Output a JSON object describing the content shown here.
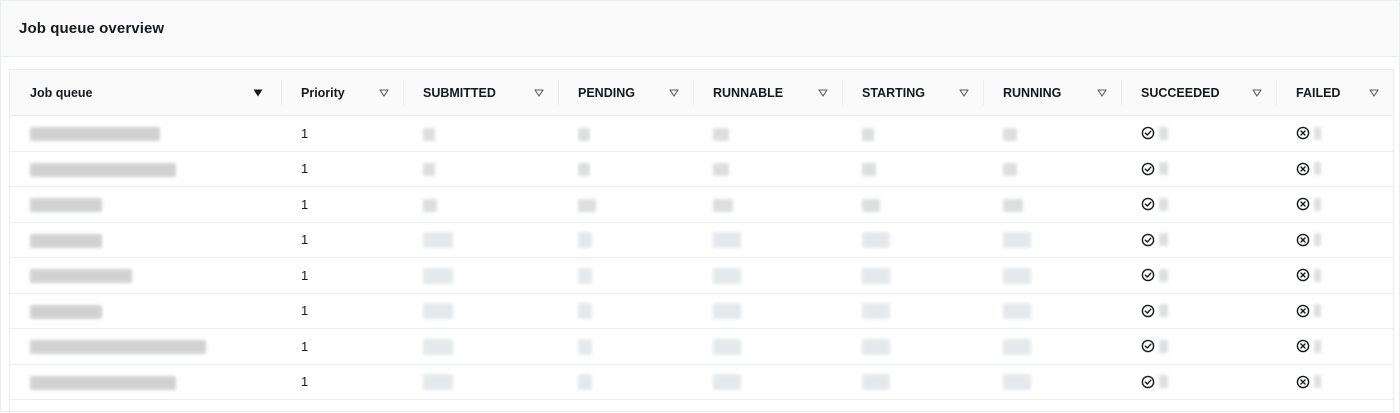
{
  "panel": {
    "title": "Job queue overview"
  },
  "table": {
    "columns": [
      {
        "key": "job_queue",
        "label": "Job queue",
        "sorted": true
      },
      {
        "key": "priority",
        "label": "Priority",
        "sorted": false
      },
      {
        "key": "submitted",
        "label": "SUBMITTED",
        "sorted": false
      },
      {
        "key": "pending",
        "label": "PENDING",
        "sorted": false
      },
      {
        "key": "runnable",
        "label": "RUNNABLE",
        "sorted": false
      },
      {
        "key": "starting",
        "label": "STARTING",
        "sorted": false
      },
      {
        "key": "running",
        "label": "RUNNING",
        "sorted": false
      },
      {
        "key": "succeeded",
        "label": "SUCCEEDED",
        "sorted": false
      },
      {
        "key": "failed",
        "label": "FAILED",
        "sorted": false
      }
    ],
    "rows": [
      {
        "job_queue": "",
        "priority": "1",
        "redacted": true
      },
      {
        "job_queue": "",
        "priority": "1",
        "redacted": true
      },
      {
        "job_queue": "",
        "priority": "1",
        "redacted": true
      },
      {
        "job_queue": "",
        "priority": "1",
        "redacted": true
      },
      {
        "job_queue": "",
        "priority": "1",
        "redacted": true
      },
      {
        "job_queue": "",
        "priority": "1",
        "redacted": true
      },
      {
        "job_queue": "",
        "priority": "1",
        "redacted": true
      },
      {
        "job_queue": "",
        "priority": "1",
        "redacted": true
      }
    ]
  },
  "icons": {
    "sort_active": "caret-down-filled-icon",
    "sort_inactive": "caret-down-outline-icon",
    "succeeded": "check-circle-icon",
    "failed": "x-circle-icon"
  },
  "colors": {
    "text": "#16191f",
    "border": "#eaeded",
    "header_bg": "#fafafa",
    "icon": "#545b64"
  }
}
